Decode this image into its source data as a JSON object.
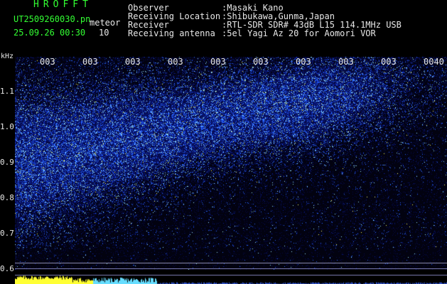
{
  "header": {
    "app_title": "HROFFT",
    "file_name": "UT2509260030.pn",
    "mode": "meteor",
    "date_time": "25.09.26 00:30",
    "interval": "10",
    "observer_label": "Observer",
    "observer_value": ":Masaki Kano",
    "location_label": "Receiving Location",
    "location_value": ":Shibukawa,Gunma,Japan",
    "receiver_label": "Receiver",
    "receiver_value": ":RTL-SDR SDR# 43dB L15 114.1MHz USB",
    "antenna_label": "Receiving antenna",
    "antenna_value": ":5el Yagi Az 20 for Aomori VOR"
  },
  "spectrogram": {
    "unit": "kHz",
    "y_ticks": [
      "1.1",
      "1.0",
      "0.9",
      "0.8",
      "0.7",
      "0.6"
    ],
    "y_range": [
      0.6,
      1.15
    ],
    "x_ticks": [
      "003",
      "003",
      "003",
      "003",
      "003",
      "003",
      "003",
      "003",
      "003",
      "0040"
    ],
    "colors": {
      "background": "#000010",
      "noise": "#0a1050",
      "signal": "#2f6cff",
      "strong": "#9fe8ff",
      "peak": "#ffff44"
    }
  }
}
